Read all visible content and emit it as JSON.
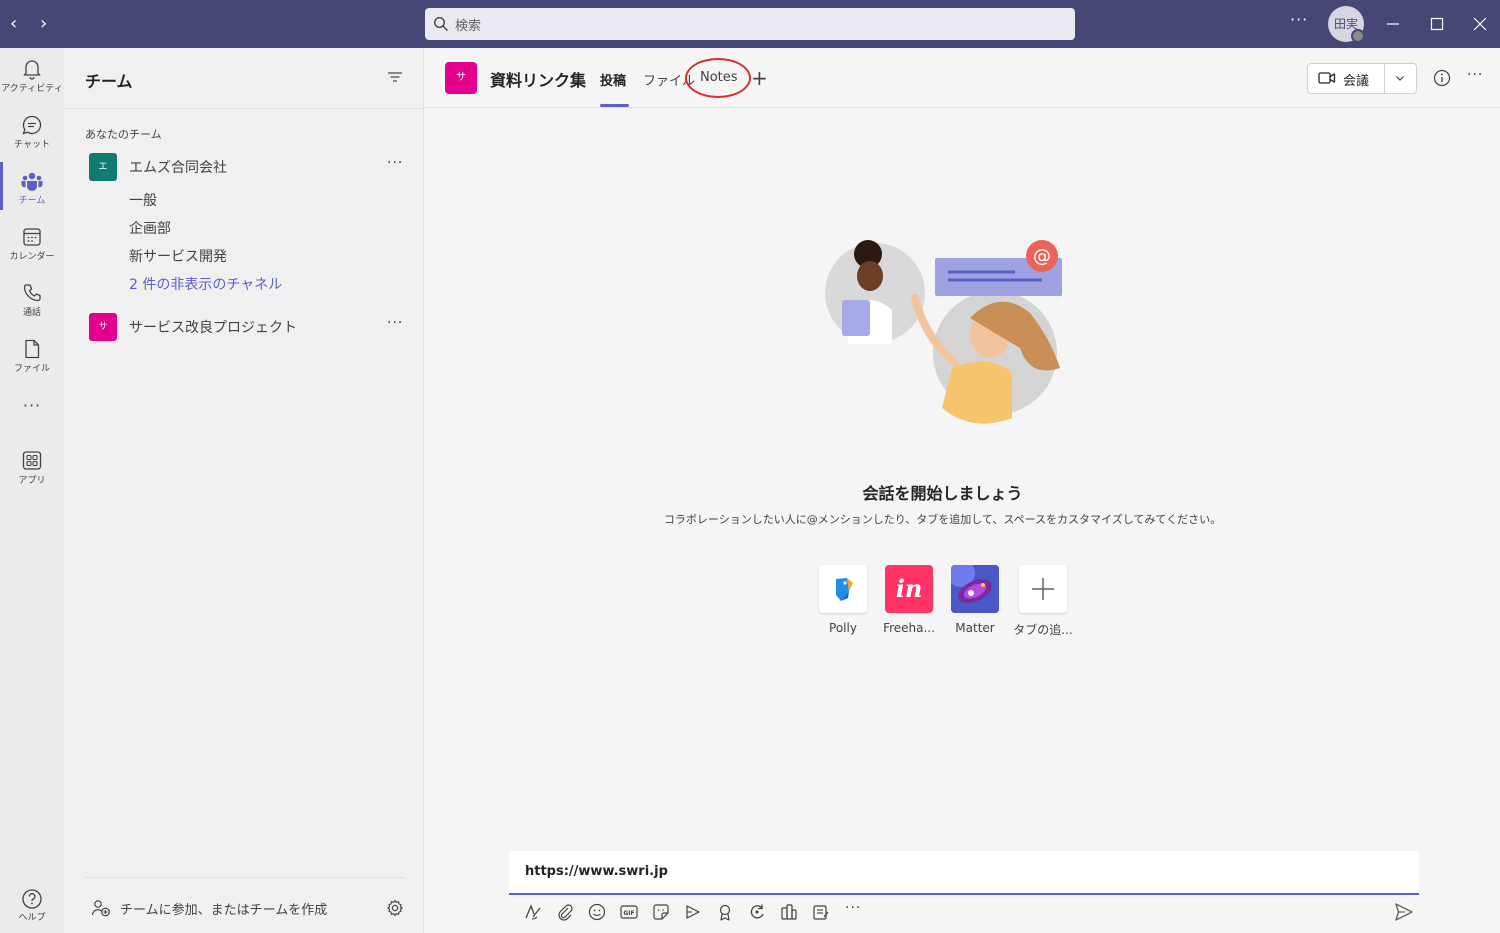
{
  "titlebar": {
    "search_placeholder": "検索",
    "avatar_initials": "田実"
  },
  "rail": {
    "items": [
      {
        "label": "アクティビティ",
        "icon": "bell-icon"
      },
      {
        "label": "チャット",
        "icon": "chat-icon"
      },
      {
        "label": "チーム",
        "icon": "teams-icon"
      },
      {
        "label": "カレンダー",
        "icon": "calendar-icon"
      },
      {
        "label": "通話",
        "icon": "phone-icon"
      },
      {
        "label": "ファイル",
        "icon": "file-icon"
      },
      {
        "label": "アプリ",
        "icon": "apps-icon"
      }
    ],
    "help_label": "ヘルプ"
  },
  "teams_panel": {
    "title": "チーム",
    "section_label": "あなたのチーム",
    "teams": [
      {
        "name": "エムズ合同会社",
        "avatar": "エ",
        "color": "#0f7b73",
        "channels": [
          "一般",
          "企画部",
          "新サービス開発"
        ],
        "hidden_link": "2 件の非表示のチャネル"
      },
      {
        "name": "サービス改良プロジェクト",
        "avatar": "サ",
        "color": "#e3008c"
      }
    ],
    "join_label": "チームに参加、またはチームを作成"
  },
  "channel_header": {
    "avatar": "サ",
    "title": "資料リンク集",
    "tabs": [
      "投稿",
      "ファイル",
      "Notes"
    ],
    "meet_label": "会議"
  },
  "empty_state": {
    "title": "会話を開始しましょう",
    "subtitle": "コラボレーションしたい人に@メンションしたり、タブを追加して、スペースをカスタマイズしてみてください。",
    "apps": [
      {
        "label": "Polly",
        "icon": "polly-icon"
      },
      {
        "label": "Freeha...",
        "icon": "invision-icon",
        "glyph": "in"
      },
      {
        "label": "Matter",
        "icon": "matter-icon"
      },
      {
        "label": "タブの追...",
        "icon": "plus-icon"
      }
    ]
  },
  "compose": {
    "text": "https://www.swri.jp"
  },
  "colors": {
    "titlebar": "#464775",
    "accent": "#5b5fc7",
    "highlight_circle": "#d32f2f"
  }
}
